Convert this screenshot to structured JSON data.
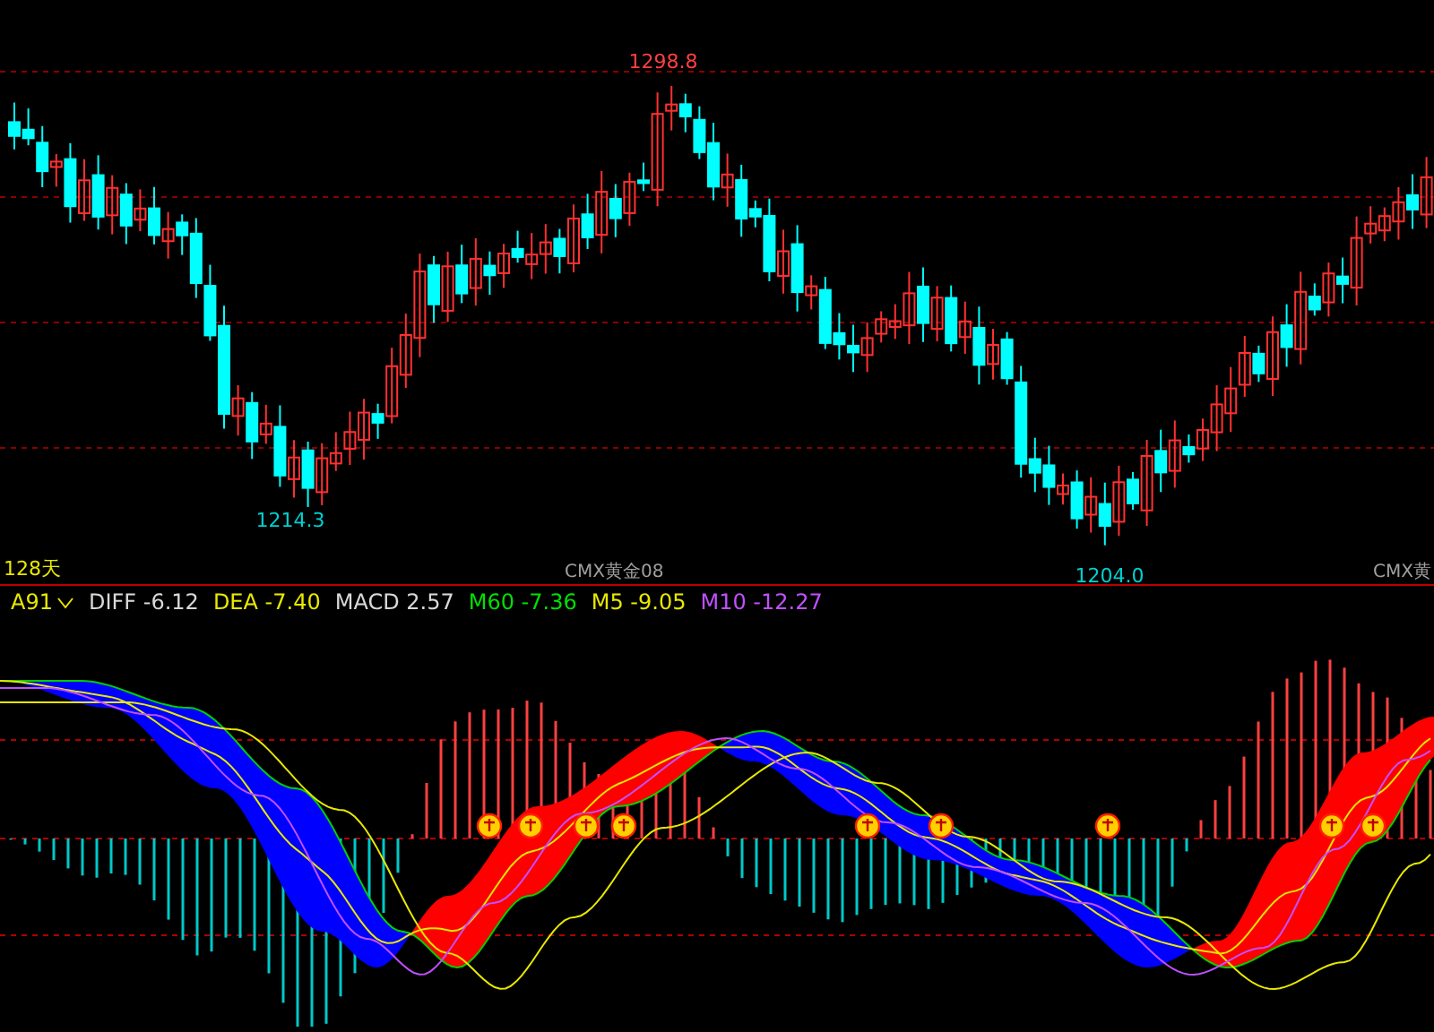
{
  "price_chart": {
    "price_labels": [
      {
        "kind": "high",
        "text": "1298.8"
      },
      {
        "kind": "low",
        "text": "1214.3"
      },
      {
        "kind": "low",
        "text": "1204.0"
      }
    ],
    "period": "128天",
    "contract_labels": [
      "CMX黄金08",
      "CMX黄"
    ]
  },
  "indicator_bar": {
    "selector": "A91",
    "items": [
      {
        "name": "DIFF",
        "value": "-6.12",
        "color": "#d8d8d8"
      },
      {
        "name": "DEA",
        "value": "-7.40",
        "color": "#e8e800"
      },
      {
        "name": "MACD",
        "value": "2.57",
        "color": "#d8d8d8"
      },
      {
        "name": "M60",
        "value": "-7.36",
        "color": "#00e000"
      },
      {
        "name": "M5",
        "value": "-9.05",
        "color": "#e8e800"
      },
      {
        "name": "M10",
        "value": "-12.27",
        "color": "#c050ff"
      }
    ]
  }
}
